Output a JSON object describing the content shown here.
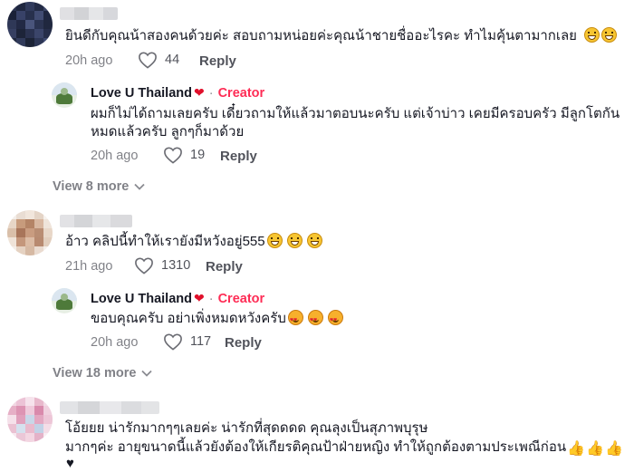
{
  "comments": [
    {
      "text": "ยินดีกับคุณน้าสองคนด้วยค่ะ สอบถามหน่อยค่ะคุณน้าชายชื่ออะไรคะ ทำไมคุ้นตามากเลย",
      "time": "20h ago",
      "likes": "44",
      "reply_label": "Reply",
      "reply": {
        "author": "Love U Thailand",
        "badge": "Creator",
        "lines": [
          "ผมก็ไม่ได้ถามเลยครับ เดี๋ยวถามให้แล้วมาตอบนะครับ แต่เจ้าบ่าว เคยมีครอบครัว มีลูกโตกัน",
          "หมดแล้วครับ ลูกๆก็มาด้วย"
        ],
        "time": "20h ago",
        "likes": "19",
        "reply_label": "Reply"
      },
      "view_more": "View 8 more"
    },
    {
      "text": "อ้าว คลิปนี้ทำให้เรายังมีหวังอยู่555",
      "time": "21h ago",
      "likes": "1310",
      "reply_label": "Reply",
      "reply": {
        "author": "Love U Thailand",
        "badge": "Creator",
        "lines": [
          "ขอบคุณครับ อย่าเพิ่งหมดหวังครับ"
        ],
        "time": "20h ago",
        "likes": "117",
        "reply_label": "Reply"
      },
      "view_more": "View 18 more"
    },
    {
      "lines": [
        "โอ้ยยย น่ารักมากๆๆเลยค่ะ น่ารักที่สุดดดด คุณลุงเป็นสุภาพบุรุษ",
        "มากๆค่ะ อายุขนาดนี้แล้วยังต้องให้เกียรติคุณป้าฝ่ายหญิง ทำให้ถูกต้องตามประเพณีก่อน"
      ]
    }
  ],
  "colors": {
    "creator": "#fe2c55",
    "heart": "#e0102b",
    "text": "#161823",
    "muted": "#8a8b91"
  }
}
